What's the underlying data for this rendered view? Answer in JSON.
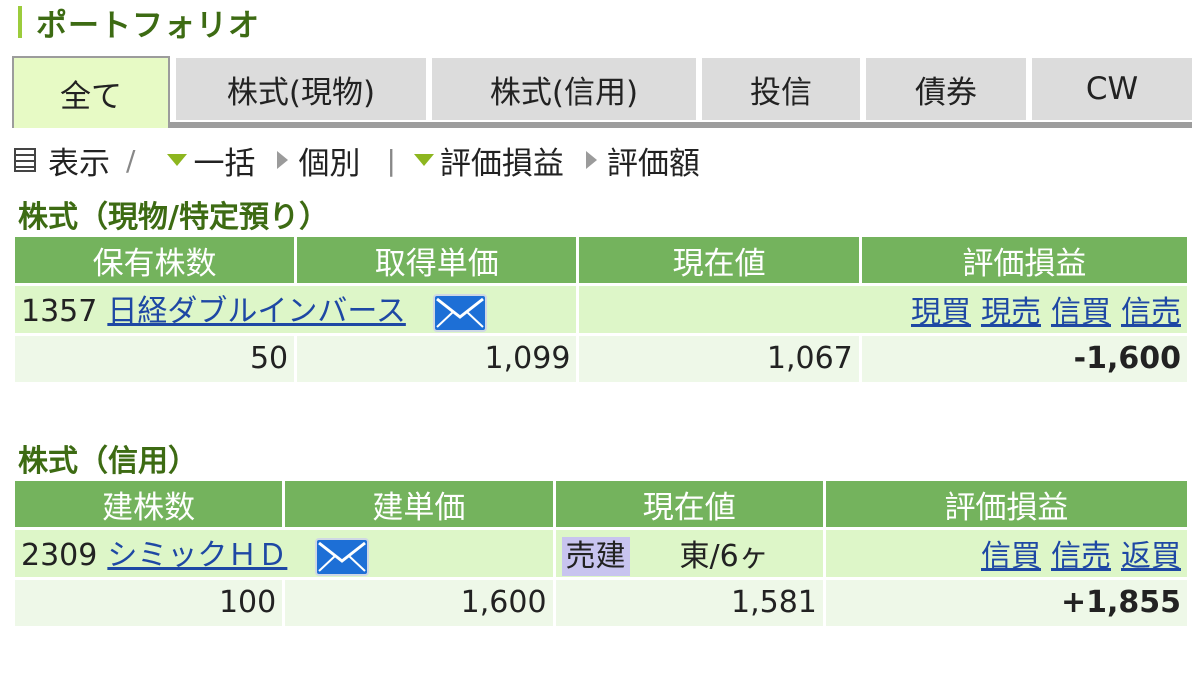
{
  "page_title": "ポートフォリオ",
  "tabs": [
    "全て",
    "株式(現物)",
    "株式(信用)",
    "投信",
    "債券",
    "CW"
  ],
  "toolbar": {
    "display_label": "表示",
    "slash": "/",
    "bulk_label": "一括",
    "individual_label": "個別",
    "pipe": "|",
    "profit_loss_label": "評価損益",
    "amount_label": "評価額"
  },
  "section_spot": {
    "title": "株式（現物/特定預り）",
    "headers": [
      "保有株数",
      "取得単価",
      "現在値",
      "評価損益"
    ],
    "code": "1357",
    "name": "日経ダブルインバース",
    "actions": [
      "現買",
      "現売",
      "信買",
      "信売"
    ],
    "quantity": "50",
    "unit_price": "1,099",
    "current_price": "1,067",
    "profit_loss": "-1,600"
  },
  "section_margin": {
    "title": "株式（信用）",
    "headers": [
      "建株数",
      "建単価",
      "現在値",
      "評価損益"
    ],
    "code": "2309",
    "name": "シミックＨＤ",
    "side": "売建",
    "market_term": "東/6ヶ",
    "actions": [
      "信買",
      "信売",
      "返買"
    ],
    "quantity": "100",
    "unit_price": "1,600",
    "current_price": "1,581",
    "profit_loss": "+1,855"
  },
  "colors": {
    "accent_green": "#74b35d",
    "title_green": "#3d6b13",
    "link_blue": "#1e48a4",
    "loss_blue": "#1530c8",
    "gain_red": "#e10f0f"
  }
}
